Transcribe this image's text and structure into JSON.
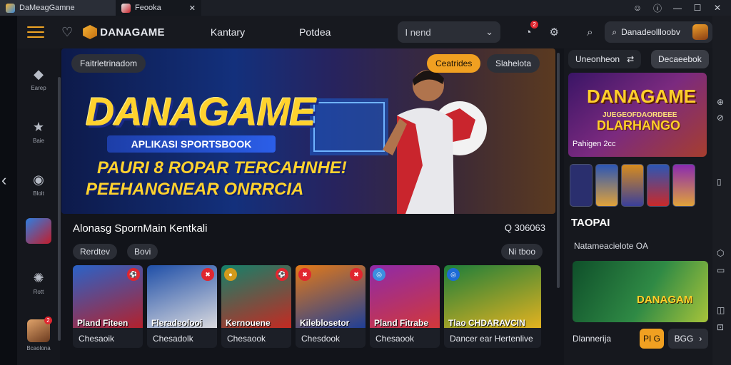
{
  "browser": {
    "tabs": [
      {
        "title": "DaMeagGamne",
        "active": true
      },
      {
        "title": "Feooka",
        "active": false
      }
    ],
    "window_controls": [
      "☺",
      "ⓘ",
      "—",
      "☐",
      "✕"
    ]
  },
  "header": {
    "brand": "DANAGAME",
    "nav": [
      "Kantary",
      "Potdea"
    ],
    "search_value": "I nend",
    "user_label": "Danadeollloobv",
    "notification_count": "2"
  },
  "rail": {
    "items": [
      {
        "label": "Earep",
        "icon": "diamond-icon"
      },
      {
        "label": "Baie",
        "icon": "star-icon"
      },
      {
        "label": "Blolt",
        "icon": "pin-icon"
      },
      {
        "label": "Rott",
        "icon": "gear-icon"
      }
    ],
    "bottom_label": "Bcaolona",
    "bottom_badge": "2"
  },
  "hero": {
    "pill_left": "Faitrletrinadom",
    "pill_right_active": "Ceatrides",
    "pill_right": "Slahelota",
    "title": "DANAGAME",
    "ribbon": "APLIKASI SPORTSBOOK",
    "line1": "PAURI 8 ROPAR TERCAHNHE!",
    "line2": "PEEHANGNEAR ONRRCIA"
  },
  "section": {
    "title": "Alonasg SpornMain Kentkali",
    "count": "Q 306063",
    "chip1": "Rerdtev",
    "chip2": "Bovi",
    "chip_right": "Ni tboo"
  },
  "cards": [
    {
      "name": "Pland Fiteen",
      "sub": "Chesaoik"
    },
    {
      "name": "Fleradeolooi",
      "sub": "Chesadolk"
    },
    {
      "name": "Kernouene",
      "sub": "Chesaook"
    },
    {
      "name": "Kileblosetor",
      "sub": "Chesdook"
    },
    {
      "name": "Pland Fitrabe",
      "sub": "Chesaook"
    },
    {
      "name": "Tlao CHDARAVCIN",
      "sub": "Dancer ear Hertenlive"
    }
  ],
  "right": {
    "tab1": "Uneonheon",
    "tab2": "Decaeebok",
    "banner_title": "DANAGAME",
    "banner_sub": "JUEGEOFDAORDEEE",
    "banner_line": "DLARHANGO",
    "banner_caption": "Pahigen 2cc",
    "heading": "TAOPAI",
    "subheading": "Natameacielote  OA",
    "promo": "DANAGAM",
    "footer_label": "Dlannerija",
    "footer_btn1": "PI G",
    "footer_btn2": "BGG"
  },
  "colors": {
    "accent": "#f0a021",
    "bg": "#12141a"
  }
}
